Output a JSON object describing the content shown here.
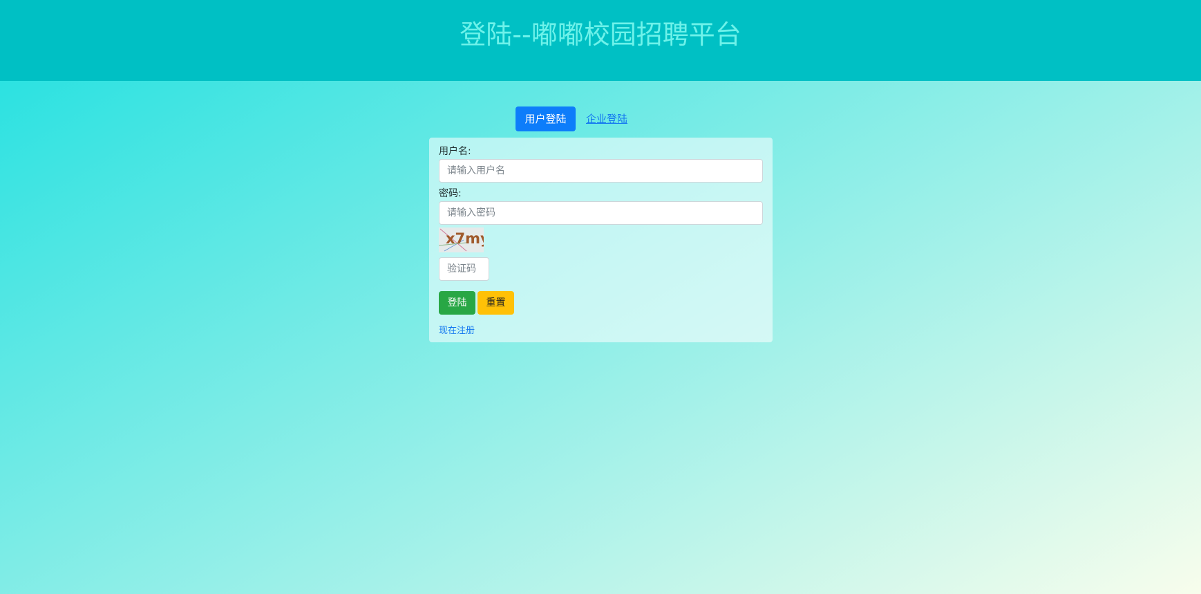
{
  "header": {
    "title": "登陆--嘟嘟校园招聘平台"
  },
  "tabs": {
    "user_login": "用户登陆",
    "company_login": "企业登陆",
    "active": "user_login"
  },
  "form": {
    "username_label": "用户名:",
    "username_placeholder": "请输入用户名",
    "username_value": "",
    "password_label": "密码:",
    "password_placeholder": "请输入密码",
    "password_value": "",
    "captcha_text": "x7my",
    "captcha_placeholder": "验证码",
    "captcha_value": "",
    "login_button": "登陆",
    "reset_button": "重置",
    "register_link": "现在注册"
  },
  "colors": {
    "header_bg": "#00c0c4",
    "title_color": "#6ef2ea",
    "primary_tab": "#0d7dfa",
    "login_button": "#28a745",
    "reset_button": "#ffc107",
    "link": "#1478f0"
  }
}
